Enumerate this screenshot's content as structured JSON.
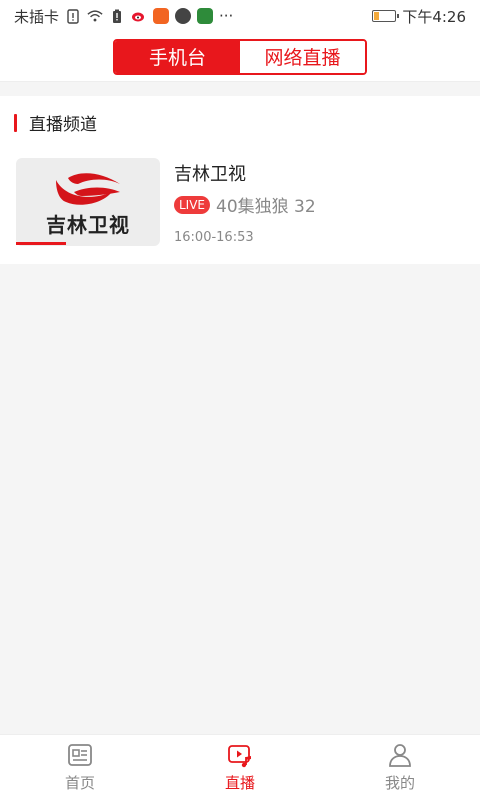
{
  "status_bar": {
    "carrier": "未插卡",
    "time": "下午4:26",
    "overflow": "···"
  },
  "header": {
    "tabs": [
      {
        "label": "手机台",
        "active": true
      },
      {
        "label": "网络直播",
        "active": false
      }
    ],
    "accent_color": "#e8171c"
  },
  "section": {
    "title": "直播频道"
  },
  "channels": [
    {
      "thumbnail_text": "吉林卫视",
      "name": "吉林卫视",
      "live_badge": "LIVE",
      "program": "40集独狼 32",
      "time": "16:00-16:53",
      "progress": 0.35
    }
  ],
  "bottom_nav": [
    {
      "label": "首页",
      "icon": "news-icon",
      "active": false
    },
    {
      "label": "直播",
      "icon": "live-play-icon",
      "active": true
    },
    {
      "label": "我的",
      "icon": "profile-icon",
      "active": false
    }
  ]
}
